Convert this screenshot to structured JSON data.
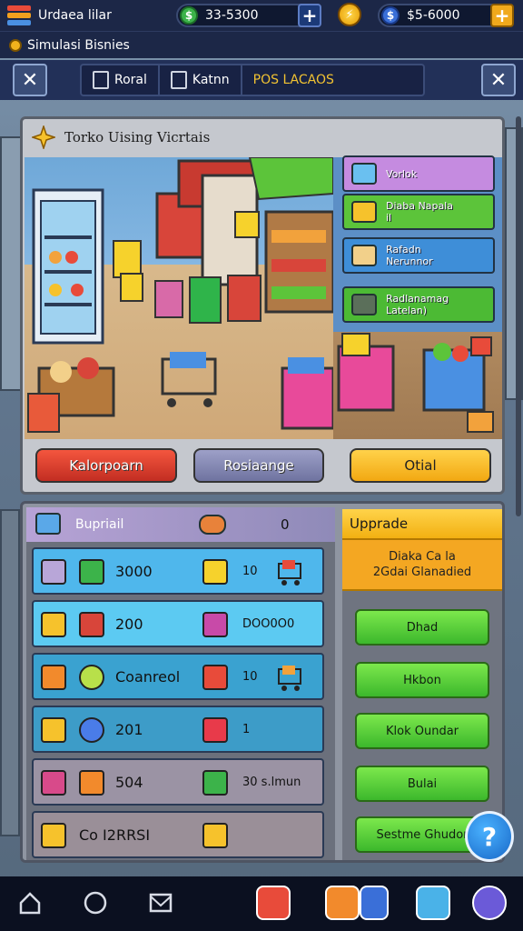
{
  "topbar": {
    "app_title": "Urdaea lilar",
    "coins": "33-5300",
    "gems": "$5-6000",
    "coin_badge": "⚡"
  },
  "subtitle": "Simulasi Bisnies",
  "tabs": [
    {
      "label": "Roral",
      "active": false
    },
    {
      "label": "Katnn",
      "active": false
    },
    {
      "label": "POS LACAOS",
      "active": true
    }
  ],
  "shop": {
    "title": "Torko Uising Vicrtais",
    "items": [
      {
        "label": "Vorlok",
        "color": "#c58be0"
      },
      {
        "label": "Diaba Napala\nil",
        "color": "#5cc43a"
      },
      {
        "label": "Rafadn\nNerunnor",
        "color": "#3e8ed8"
      },
      {
        "label": "Radlanamag\nLatelan)",
        "color": "#4cba34"
      }
    ],
    "buttons": {
      "left": "Kalorpoarn",
      "middle": "Rosiaange",
      "right": "Otial"
    }
  },
  "stats": {
    "header_label": "Bupriail",
    "header_value": "0",
    "rows": [
      {
        "value": "3000",
        "value2": "10",
        "color": "#4fb7ec"
      },
      {
        "value": "200",
        "value2": "DOO0O0",
        "color": "#5ccaf2"
      },
      {
        "value": "Coanreol",
        "value2": "10",
        "color": "#3aa2d0"
      },
      {
        "value": "201",
        "value2": "1",
        "color": "#3d9cc8"
      },
      {
        "value": "504",
        "value2": "30 s.lmun",
        "color": "#9b93a4"
      },
      {
        "value": "Co I2RRSI",
        "value2": "",
        "color": "#9a8f98"
      }
    ]
  },
  "upgrade": {
    "title": "Upprade",
    "subtitle_line1": "Diaka Ca la",
    "subtitle_line2": "2Gdai Glanadied",
    "buttons": [
      "Dhad",
      "Hkbon",
      "Klok Oundar",
      "Bulai",
      "Sestme Ghudor"
    ]
  },
  "help_icon": "?"
}
